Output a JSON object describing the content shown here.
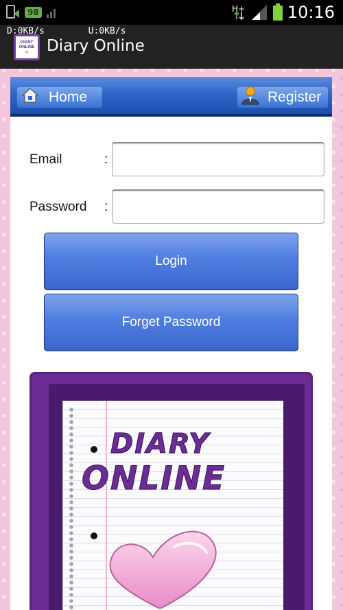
{
  "status_bar": {
    "battery_badge": "98",
    "network_type": "H+",
    "time": "10:16",
    "download_speed": "D:0KB/s",
    "upload_speed": "U:0KB/s"
  },
  "app_bar": {
    "title": "Diary Online",
    "logo_text_1": "DIARY",
    "logo_text_2": "ONLINE"
  },
  "nav": {
    "home_label": "Home",
    "register_label": "Register"
  },
  "form": {
    "email_label": "Email",
    "password_label": "Password",
    "colon": ":",
    "email_value": "",
    "password_value": "",
    "login_label": "Login",
    "forget_password_label": "Forget Password"
  },
  "banner": {
    "line1": "DIARY",
    "line2": "ONLINE"
  },
  "colors": {
    "nav_blue": "#2f66c8",
    "button_blue": "#4f7ee0",
    "notebook_purple": "#6a2c92",
    "background_pink": "#f2c6dc",
    "heart_pink": "#f4b6dc"
  }
}
